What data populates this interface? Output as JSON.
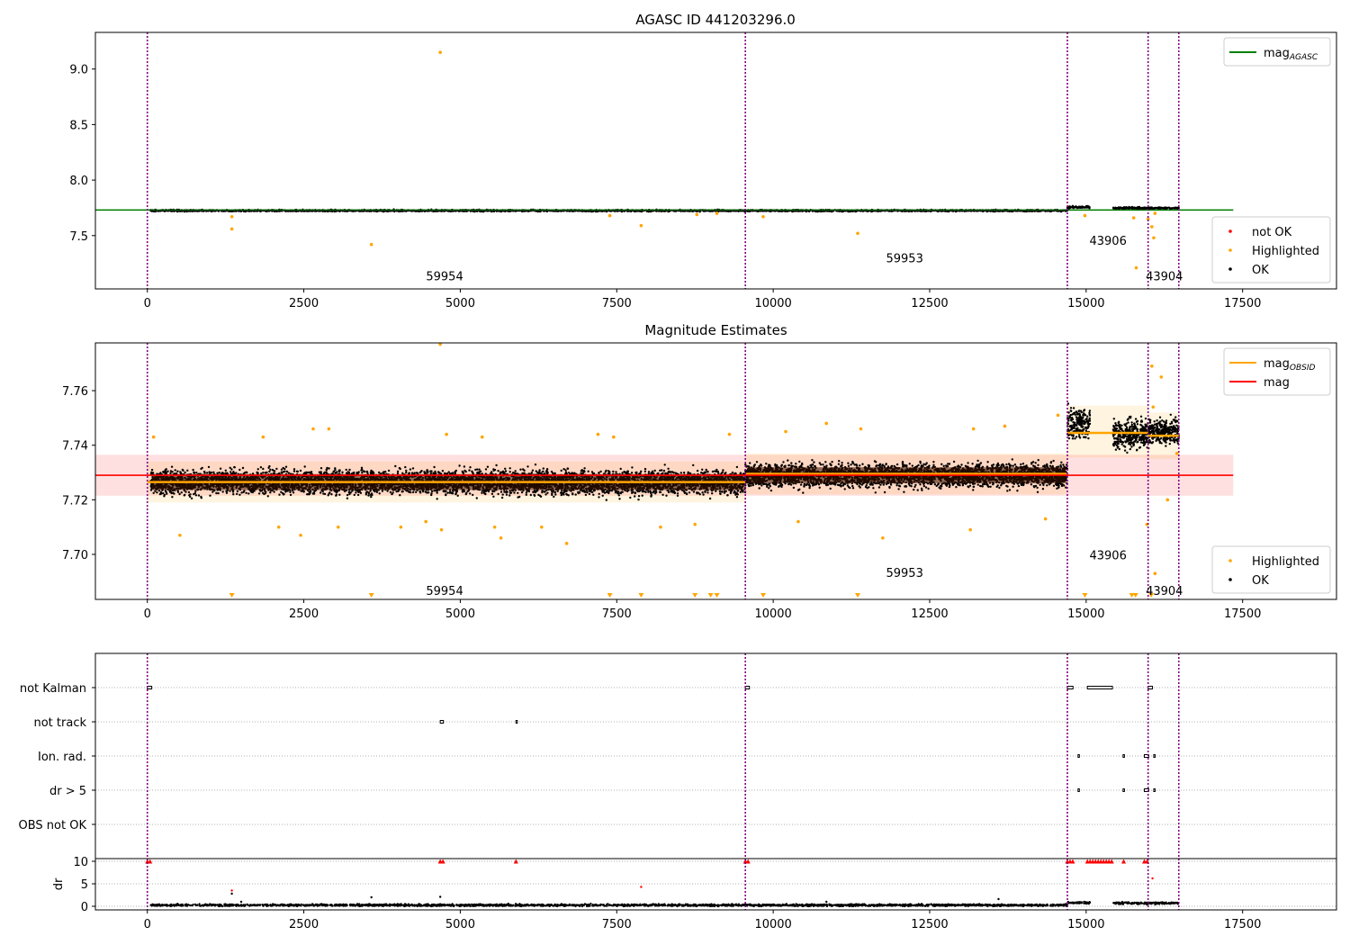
{
  "figure": {
    "title": "AGASC ID 441203296.0"
  },
  "chart_data": [
    {
      "type": "scatter",
      "title": "AGASC ID 441203296.0",
      "xlim": [
        -830,
        19000
      ],
      "ylim": [
        7.02,
        9.33
      ],
      "xticks": [
        0,
        2500,
        5000,
        7500,
        10000,
        12500,
        15000,
        17500
      ],
      "yticks": [
        7.5,
        8.0,
        8.5,
        9.0
      ],
      "obs_boundaries": [
        0,
        9555,
        14700,
        15990,
        16480
      ],
      "obs_labels": [
        {
          "text": "59954",
          "x": 4750,
          "y": 7.13
        },
        {
          "text": "59953",
          "x": 12100,
          "y": 7.29
        },
        {
          "text": "43906",
          "x": 15350,
          "y": 7.45
        },
        {
          "text": "43904",
          "x": 16250,
          "y": 7.13
        }
      ],
      "reference_line": {
        "name": "mag_AGASC",
        "y": 7.73,
        "x": [
          -830,
          17350
        ]
      },
      "ok_segments": [
        {
          "x": [
            50,
            14700
          ],
          "y": 7.725,
          "spread": 0.012
        },
        {
          "x": [
            14700,
            15060
          ],
          "y": 7.755,
          "spread": 0.015
        },
        {
          "x": [
            15430,
            16480
          ],
          "y": 7.748,
          "spread": 0.015
        }
      ],
      "highlighted_points": [
        [
          1350,
          7.56
        ],
        [
          1350,
          7.67
        ],
        [
          3580,
          7.42
        ],
        [
          4680,
          9.15
        ],
        [
          7390,
          7.68
        ],
        [
          7890,
          7.59
        ],
        [
          8780,
          7.69
        ],
        [
          9100,
          7.7
        ],
        [
          9840,
          7.67
        ],
        [
          11350,
          7.52
        ],
        [
          14980,
          7.68
        ],
        [
          15760,
          7.66
        ],
        [
          15800,
          7.21
        ],
        [
          15990,
          7.65
        ],
        [
          16050,
          7.58
        ],
        [
          16080,
          7.48
        ],
        [
          16100,
          7.7
        ]
      ],
      "legends": [
        {
          "position": "upper-right",
          "entries": [
            {
              "label": "mag",
              "subscript": "AGASC",
              "color": "#008000",
              "marker": "line"
            }
          ]
        },
        {
          "position": "lower-right",
          "entries": [
            {
              "label": "not OK",
              "color": "#ff0000",
              "marker": "dot"
            },
            {
              "label": "Highlighted",
              "color": "#ffa500",
              "marker": "dot"
            },
            {
              "label": "OK",
              "color": "#000000",
              "marker": "dot"
            }
          ]
        }
      ]
    },
    {
      "type": "scatter",
      "title": "Magnitude Estimates",
      "xlim": [
        -830,
        19000
      ],
      "ylim": [
        7.6835,
        7.7775
      ],
      "xticks": [
        0,
        2500,
        5000,
        7500,
        10000,
        12500,
        15000,
        17500
      ],
      "yticks": [
        7.7,
        7.72,
        7.74,
        7.76
      ],
      "obs_boundaries": [
        0,
        9555,
        14700,
        15990,
        16480
      ],
      "obs_labels": [
        {
          "text": "59954",
          "x": 4750,
          "y": 7.6865
        },
        {
          "text": "59953",
          "x": 12100,
          "y": 7.693
        },
        {
          "text": "43906",
          "x": 15350,
          "y": 7.6995
        },
        {
          "text": "43904",
          "x": 16250,
          "y": 7.6865
        }
      ],
      "mag_line": {
        "name": "mag",
        "y": 7.729,
        "band": [
          7.7215,
          7.7365
        ],
        "x": [
          -830,
          17350
        ]
      },
      "obsid_lines": [
        {
          "x": [
            0,
            9555
          ],
          "y": 7.7265,
          "band": [
            7.719,
            7.734
          ]
        },
        {
          "x": [
            9555,
            14700
          ],
          "y": 7.7295,
          "band": [
            7.722,
            7.737
          ]
        },
        {
          "x": [
            14700,
            15990
          ],
          "y": 7.7445,
          "band": [
            7.7355,
            7.7545
          ]
        },
        {
          "x": [
            15990,
            16480
          ],
          "y": 7.7435,
          "band": [
            7.735,
            7.752
          ]
        }
      ],
      "ok_segments": [
        {
          "x": [
            50,
            9555
          ],
          "y": 7.7265,
          "spread": 0.0065
        },
        {
          "x": [
            9555,
            14700
          ],
          "y": 7.729,
          "spread": 0.0065
        },
        {
          "x": [
            14700,
            15060
          ],
          "y": 7.748,
          "spread": 0.008
        },
        {
          "x": [
            15430,
            15990
          ],
          "y": 7.744,
          "spread": 0.008
        },
        {
          "x": [
            15990,
            16480
          ],
          "y": 7.745,
          "spread": 0.007
        }
      ],
      "highlighted_points": [
        [
          100,
          7.743
        ],
        [
          520,
          7.707
        ],
        [
          1850,
          7.743
        ],
        [
          2100,
          7.71
        ],
        [
          2450,
          7.707
        ],
        [
          2650,
          7.746
        ],
        [
          2900,
          7.746
        ],
        [
          3050,
          7.71
        ],
        [
          4050,
          7.71
        ],
        [
          4450,
          7.712
        ],
        [
          4700,
          7.709
        ],
        [
          4680,
          7.7775
        ],
        [
          4780,
          7.744
        ],
        [
          5350,
          7.743
        ],
        [
          5550,
          7.71
        ],
        [
          5650,
          7.706
        ],
        [
          6300,
          7.71
        ],
        [
          6700,
          7.704
        ],
        [
          7200,
          7.744
        ],
        [
          7450,
          7.743
        ],
        [
          8200,
          7.71
        ],
        [
          8750,
          7.711
        ],
        [
          9300,
          7.744
        ],
        [
          10200,
          7.745
        ],
        [
          10400,
          7.712
        ],
        [
          10850,
          7.748
        ],
        [
          11400,
          7.746
        ],
        [
          11750,
          7.706
        ],
        [
          13150,
          7.709
        ],
        [
          13200,
          7.746
        ],
        [
          13700,
          7.747
        ],
        [
          14350,
          7.713
        ],
        [
          14550,
          7.751
        ],
        [
          15970,
          7.711
        ],
        [
          16050,
          7.769
        ],
        [
          16070,
          7.754
        ],
        [
          16100,
          7.693
        ],
        [
          16200,
          7.765
        ],
        [
          16300,
          7.72
        ],
        [
          16450,
          7.737
        ]
      ],
      "below_range_markers": [
        1350,
        3580,
        7390,
        7890,
        8750,
        9000,
        9100,
        9840,
        11350,
        14980,
        15730,
        15790,
        16040
      ],
      "legends": [
        {
          "position": "upper-right",
          "entries": [
            {
              "label": "mag",
              "subscript": "OBSID",
              "color": "#ffa500",
              "marker": "line"
            },
            {
              "label": "mag",
              "subscript": "",
              "color": "#ff0000",
              "marker": "line"
            }
          ]
        },
        {
          "position": "lower-right",
          "entries": [
            {
              "label": "Highlighted",
              "color": "#ffa500",
              "marker": "dot"
            },
            {
              "label": "OK",
              "color": "#000000",
              "marker": "dot"
            }
          ]
        }
      ]
    },
    {
      "type": "scatter",
      "title": "",
      "xlim": [
        -830,
        19000
      ],
      "xticks": [
        0,
        2500,
        5000,
        7500,
        10000,
        12500,
        15000,
        17500
      ],
      "obs_boundaries": [
        0,
        9555,
        14700,
        15990,
        16480
      ],
      "flag_categories": [
        "not Kalman",
        "not track",
        "Ion. rad.",
        "dr > 5",
        "OBS not OK"
      ],
      "flag_points": [
        {
          "category": "not Kalman",
          "ranges": [
            [
              0,
              70
            ],
            [
              9555,
              9620
            ],
            [
              14700,
              14790
            ],
            [
              15020,
              15420
            ],
            [
              15990,
              16060
            ]
          ]
        },
        {
          "category": "not track",
          "ranges": [
            [
              4680,
              4730
            ],
            [
              5890,
              5900
            ]
          ]
        },
        {
          "category": "Ion. rad.",
          "ranges": [
            [
              14870,
              14880
            ],
            [
              15590,
              15600
            ],
            [
              15930,
              16000
            ],
            [
              16080,
              16090
            ]
          ]
        },
        {
          "category": "dr > 5",
          "ranges": [
            [
              14870,
              14880
            ],
            [
              15590,
              15600
            ],
            [
              15930,
              16000
            ],
            [
              16080,
              16090
            ]
          ]
        },
        {
          "category": "OBS not OK",
          "ranges": []
        }
      ],
      "dr": {
        "ylabel": "dr",
        "yticks": [
          0,
          5,
          10
        ],
        "ylim": [
          -0.8,
          10.6
        ],
        "red_ranges": [
          [
            0,
            70
          ],
          [
            4680,
            4730
          ],
          [
            5890,
            5900
          ],
          [
            9555,
            9620
          ],
          [
            14700,
            14790
          ],
          [
            15020,
            15420
          ],
          [
            15600,
            15610
          ],
          [
            15930,
            16000
          ]
        ],
        "black_segments": [
          {
            "x": [
              50,
              14700
            ],
            "y": 0.25
          },
          {
            "x": [
              14700,
              15060
            ],
            "y": 0.8
          },
          {
            "x": [
              15430,
              16480
            ],
            "y": 0.7
          }
        ],
        "outliers": [
          [
            1350,
            2.8
          ],
          [
            1350,
            3.5
          ],
          [
            1500,
            1.0
          ],
          [
            3580,
            2.0
          ],
          [
            4680,
            2.1
          ],
          [
            7890,
            4.3
          ],
          [
            10850,
            1.0
          ],
          [
            13600,
            1.6
          ],
          [
            16060,
            6.2
          ]
        ]
      }
    }
  ],
  "colors": {
    "ok": "#000000",
    "highlighted": "#ffa500",
    "not_ok": "#ff0000",
    "agasc_line": "#008000",
    "mag_line": "#ff0000",
    "obsid_line": "#ffa500",
    "boundary": "#800080"
  }
}
